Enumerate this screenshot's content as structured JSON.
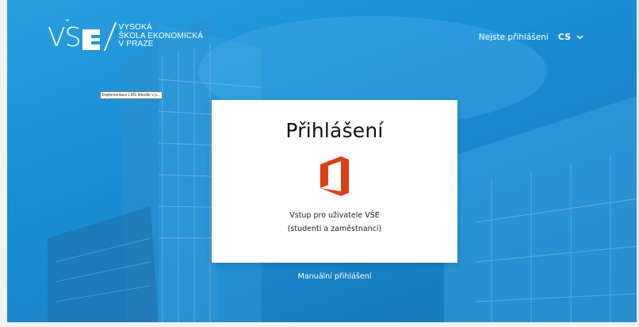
{
  "logo": {
    "mark_vs": "VS",
    "mark_caron": "ˇ",
    "lines": [
      "VYSOKÁ",
      "ŠKOLA EKONOMICKÁ",
      "V PRAZE"
    ]
  },
  "header": {
    "status": "Nejste přihlášeni",
    "language": "CS",
    "language_chevron_icon": "chevron-down-icon"
  },
  "tooltip": {
    "text": "Implementace LMS Moodle v p..."
  },
  "login_card": {
    "title": "Přihlášení",
    "provider_icon": "office365-icon",
    "line1": "Vstup pro uživatele VŠE",
    "line2": "(studenti a zaměstnanci)"
  },
  "manual_login": {
    "label": "Manuální přihlášení"
  },
  "colors": {
    "background_blue": "#1b8fd6",
    "office_orange": "#dc3e15",
    "card_bg": "#ffffff",
    "text_white": "#ffffff"
  }
}
